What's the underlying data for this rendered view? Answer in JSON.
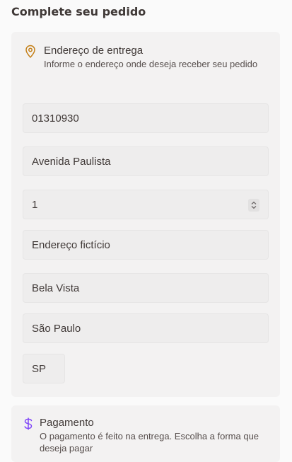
{
  "page": {
    "title": "Complete seu pedido"
  },
  "address": {
    "title": "Endereço de entrega",
    "subtitle": "Informe o endereço onde deseja receber seu pedido",
    "icon": "map-pin-icon",
    "icon_color": "#c47f17",
    "fields": {
      "cep": "01310930",
      "street": "Avenida Paulista",
      "number": "1",
      "complement": "Endereço fictício",
      "neighborhood": "Bela Vista",
      "city": "São Paulo",
      "state": "SP"
    }
  },
  "payment": {
    "title": "Pagamento",
    "subtitle": "O pagamento é feito na entrega. Escolha a forma que deseja pagar",
    "icon": "dollar-icon",
    "icon_color": "#8047f8"
  }
}
